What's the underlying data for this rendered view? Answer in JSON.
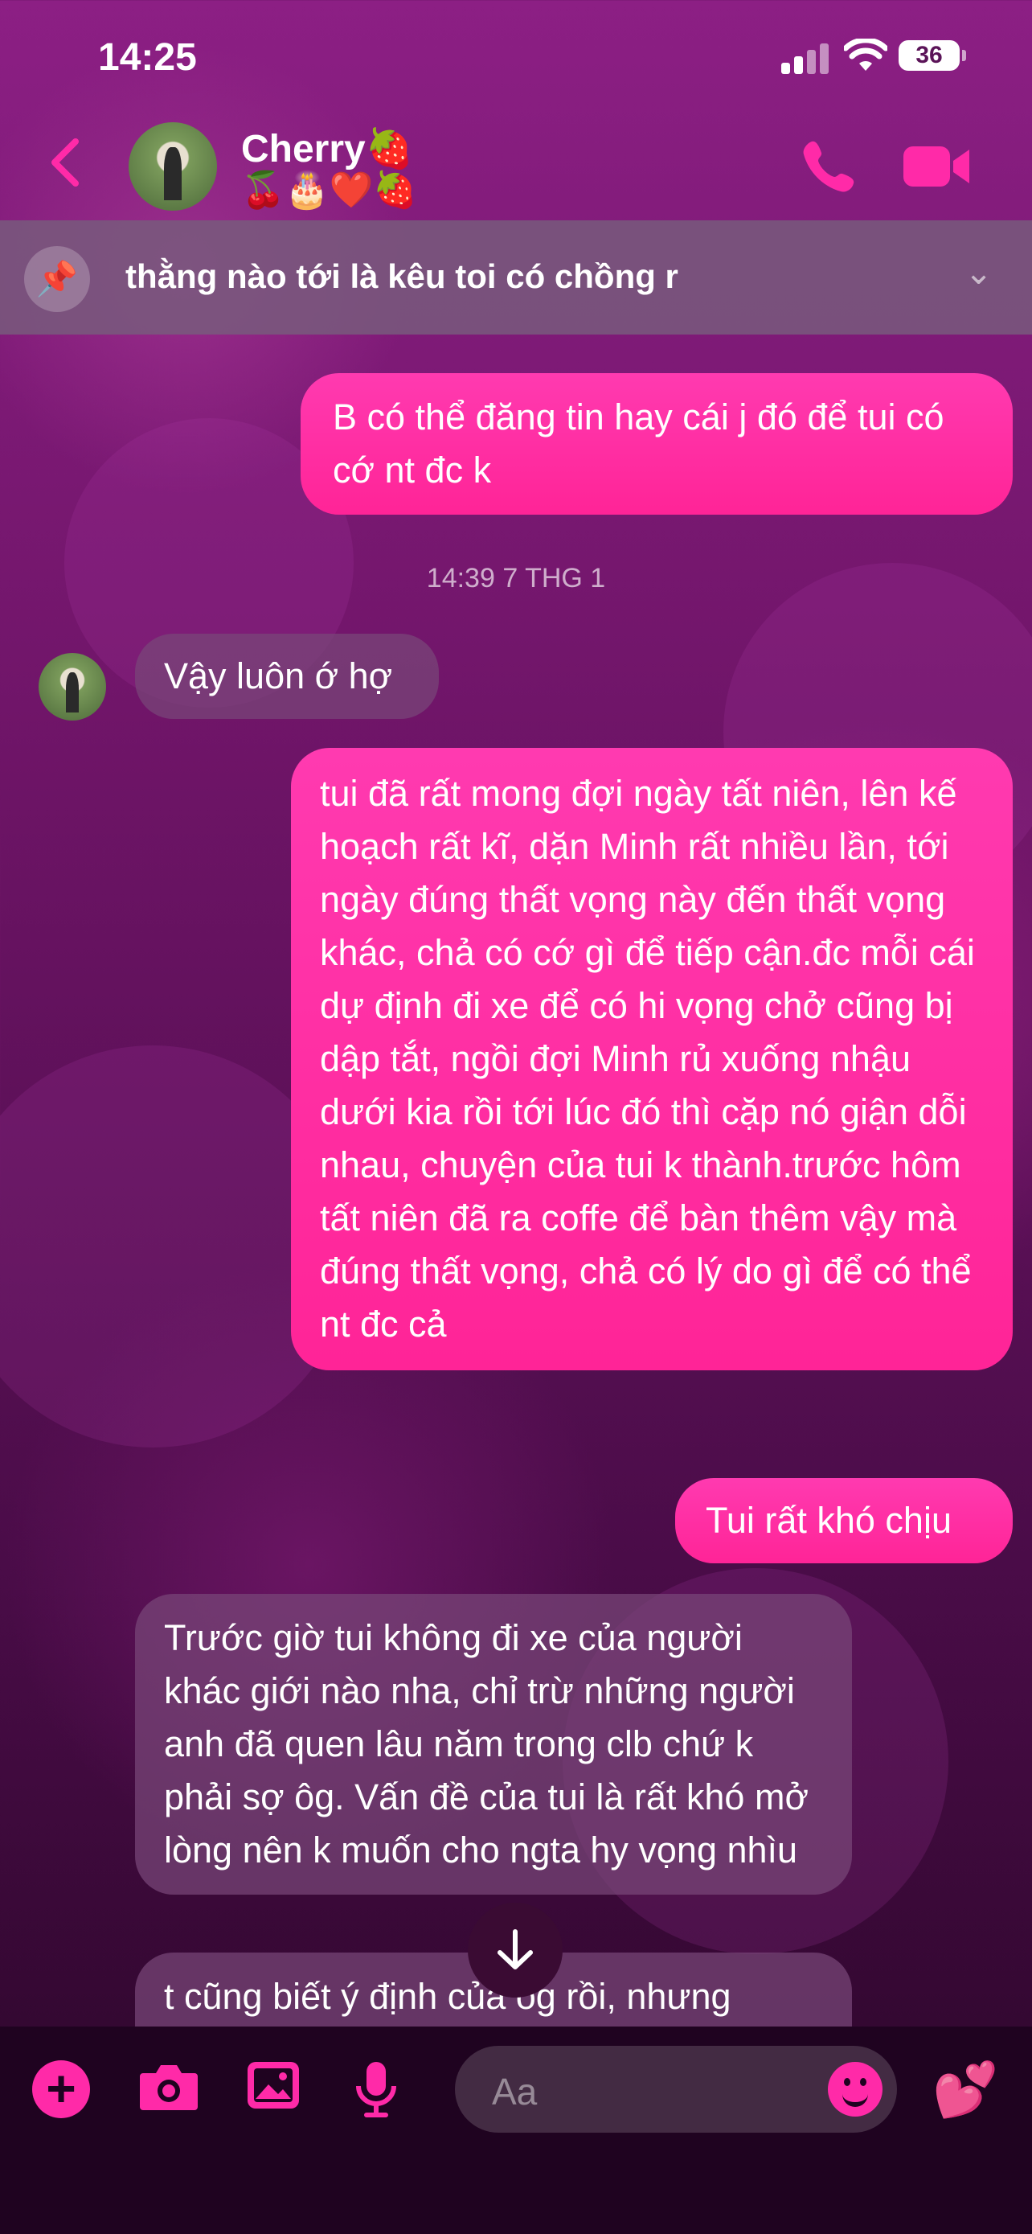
{
  "status_bar": {
    "time": "14:25",
    "battery": "36"
  },
  "header": {
    "contact_name": "Cherry🍓",
    "contact_emoji": "🍒🎂❤️🍓",
    "icons": {
      "back": "chevron-left-icon",
      "call": "phone-icon",
      "video": "video-camera-icon"
    }
  },
  "pinned": {
    "text": "thằng nào tới là kêu toi có chồng r"
  },
  "messages": [
    {
      "timestamp": "14:39 7 THG 1"
    },
    {
      "sender": "me",
      "text": "B có thể đăng tin hay cái j đó để tui có cớ nt đc k"
    },
    {
      "sender": "contact",
      "text": "Vậy luôn ớ hợ"
    },
    {
      "sender": "me",
      "text": "tui đã rất mong đợi ngày tất niên, lên kế hoạch rất kĩ, dặn Minh rất nhiều lần, tới ngày đúng thất vọng này đến thất vọng khác, chả có cớ gì để tiếp cận.đc mỗi cái dự định đi xe để có hi vọng chở cũng bị dập tắt, ngồi đợi Minh rủ xuống nhậu dưới kia rồi tới lúc đó thì cặp nó giận dỗi nhau, chuyện của tui k thành.trước hôm tất niên đã ra coffe để bàn thêm vậy mà đúng thất vọng, chả có lý do gì để có thể nt đc cả"
    },
    {
      "sender": "me",
      "text": "Tui rất khó chịu"
    },
    {
      "sender": "contact",
      "text": "Trước giờ tui không đi xe của người khác giới nào nha, chỉ trừ những người anh đã quen lâu năm trong clb chứ k phải sợ ôg. Vấn đề của tui là rất khó mở lòng nên k muốn cho ngta hy vọng nhìu"
    },
    {
      "sender": "contact",
      "text": "t cũng biết ý định của ôg rồi, nhưng"
    }
  ],
  "composer": {
    "placeholder": "Aa",
    "send_icon": "hearts-icon"
  },
  "colors": {
    "accent": "#ff2aa8",
    "outgoing_bubble": "#ff2497",
    "background": "#6d1466"
  }
}
